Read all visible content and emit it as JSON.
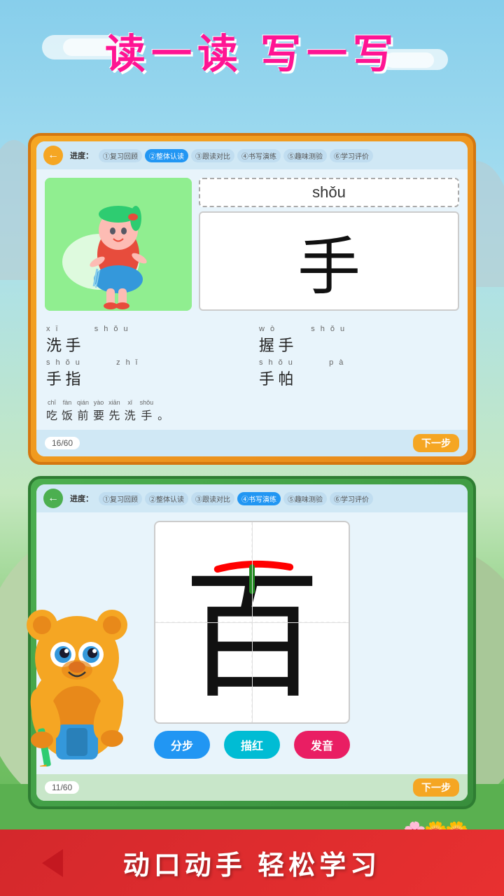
{
  "background": {
    "sky_color_top": "#87CEEB",
    "sky_color_bottom": "#a8dff0",
    "grass_color": "#5ab050"
  },
  "title": "读一读  写一写",
  "card_top": {
    "back_button": "←",
    "progress_label": "进度：",
    "steps": [
      {
        "label": "①复习回顾",
        "active": false
      },
      {
        "label": "②整体认读",
        "active": true
      },
      {
        "label": "③跟读对比",
        "active": false
      },
      {
        "label": "④书写演练",
        "active": false
      },
      {
        "label": "⑤趣味测验",
        "active": false
      },
      {
        "label": "⑥学习评价",
        "active": false
      }
    ],
    "pinyin": "shǒu",
    "character": "手",
    "words": [
      {
        "pinyin_top": "xī",
        "pinyin_bot": "shǒu",
        "chars": "洗 手"
      },
      {
        "pinyin_top": "wò",
        "pinyin_bot": "shǒu",
        "chars": "握 手"
      },
      {
        "pinyin_top": "shǒu",
        "pinyin_bot": "zhǐ",
        "chars": "手 指"
      },
      {
        "pinyin_top": "shǒu",
        "pinyin_bot": "pà",
        "chars": "手 帕"
      }
    ],
    "sentence_pinyins": "chī fàn qián yào xiān xǐ shǒu",
    "sentence": "吃 饭 前 要 先 洗 手。",
    "counter": "16/60",
    "next_label": "下一步"
  },
  "card_bottom": {
    "back_button": "←",
    "progress_label": "进度：",
    "steps": [
      {
        "label": "①复习回顾",
        "active": false
      },
      {
        "label": "②整体认读",
        "active": false
      },
      {
        "label": "③跟读对比",
        "active": false
      },
      {
        "label": "④书写演练",
        "active": true
      },
      {
        "label": "⑤趣味测验",
        "active": false
      },
      {
        "label": "⑥学习评价",
        "active": false
      }
    ],
    "character": "百",
    "btn_step": "分步",
    "btn_trace": "描红",
    "btn_sound": "发音",
    "counter": "11/60",
    "next_label": "下一步"
  },
  "bottom_banner": {
    "text": "动口动手  轻松学习"
  },
  "mascot": {
    "name": "bear"
  }
}
